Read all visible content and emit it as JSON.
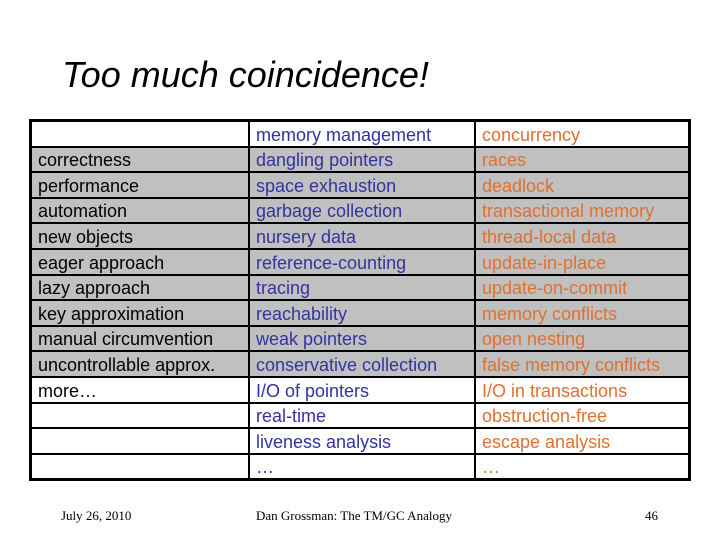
{
  "slide": {
    "title": "Too much coincidence!"
  },
  "table": {
    "header": [
      "",
      "memory management",
      "concurrency"
    ],
    "rows": [
      [
        "correctness",
        "dangling pointers",
        "races"
      ],
      [
        "performance",
        "space exhaustion",
        "deadlock"
      ],
      [
        "automation",
        "garbage collection",
        "transactional memory"
      ],
      [
        "new objects",
        "nursery data",
        "thread-local data"
      ],
      [
        "eager approach",
        "reference-counting",
        "update-in-place"
      ],
      [
        "lazy approach",
        "tracing",
        "update-on-commit"
      ],
      [
        "key approximation",
        "reachability",
        "memory conflicts"
      ],
      [
        "manual circumvention",
        "weak pointers",
        "open nesting"
      ],
      [
        "uncontrollable approx.",
        "conservative collection",
        "false memory conflicts"
      ],
      [
        "more…",
        "I/O of pointers",
        "I/O in transactions"
      ],
      [
        "",
        "real-time",
        "obstruction-free"
      ],
      [
        "",
        "liveness analysis",
        "escape analysis"
      ],
      [
        "",
        "…",
        "…"
      ]
    ],
    "colors": {
      "memory_management_text": "#3333a0",
      "concurrency_text": "#e07030",
      "shaded_row_bg": "#c0c0c0"
    }
  },
  "footer": {
    "date": "July 26, 2010",
    "center": "Dan Grossman: The TM/GC Analogy",
    "page_number": "46"
  }
}
